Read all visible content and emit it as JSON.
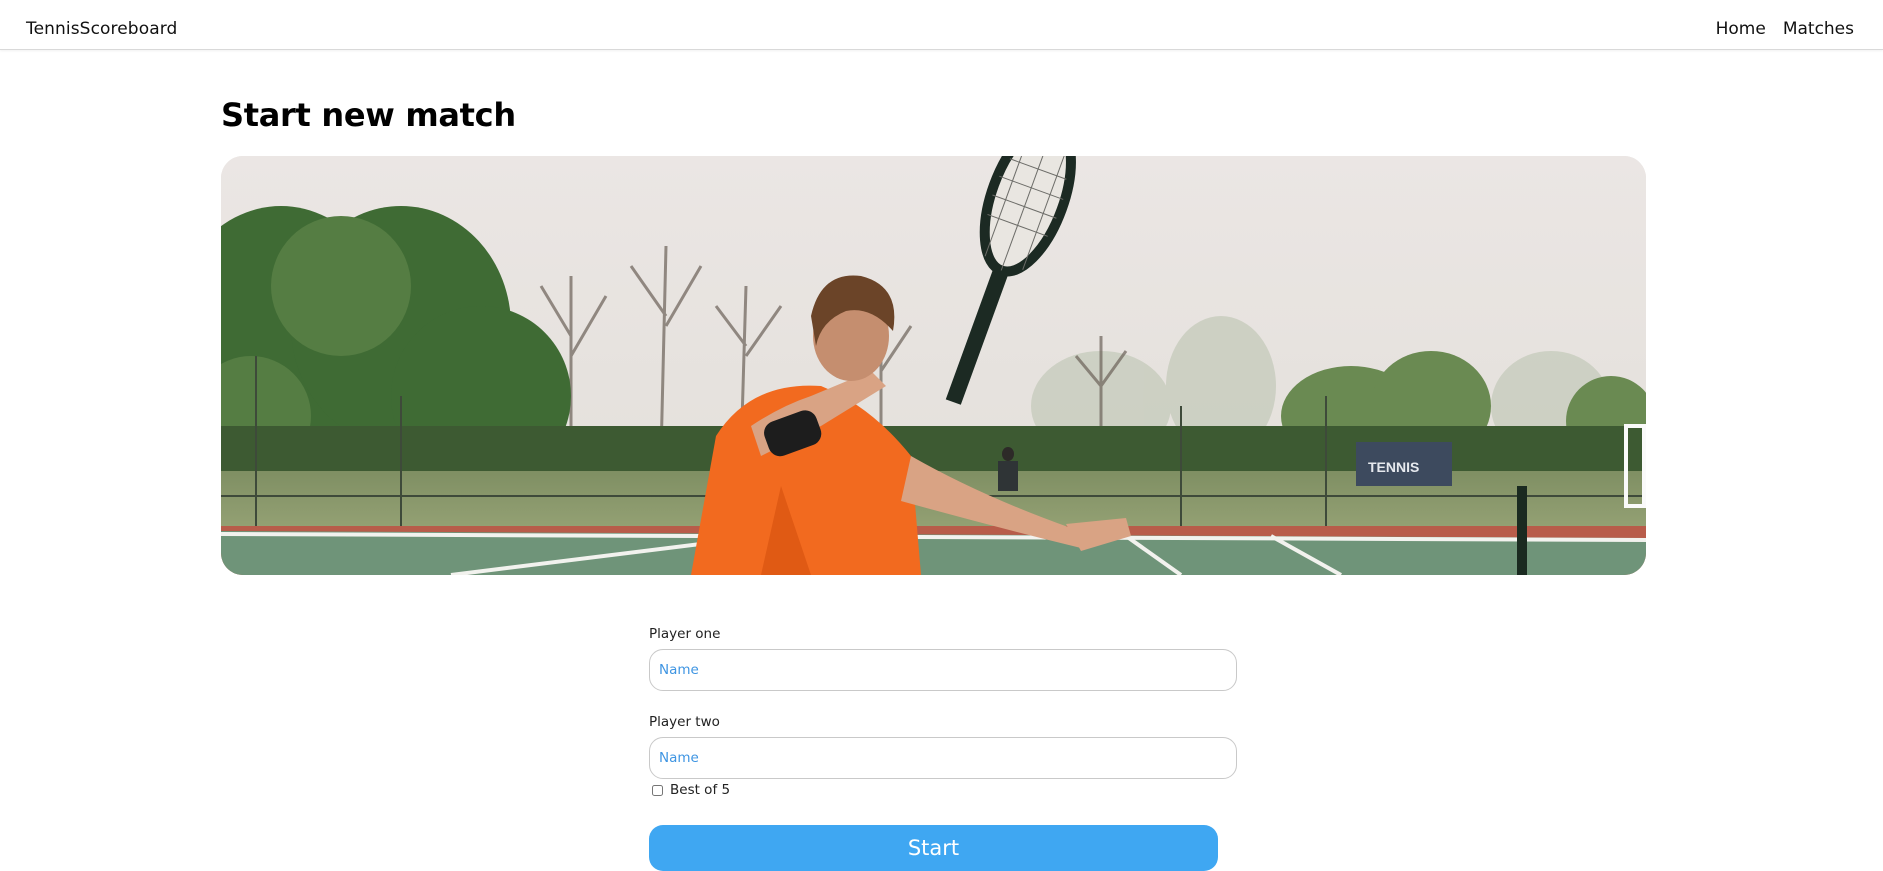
{
  "header": {
    "brand": "TennisScoreboard",
    "nav": {
      "home": "Home",
      "matches": "Matches"
    }
  },
  "main": {
    "title": "Start new match",
    "hero": {
      "sign_text": "TENNIS"
    },
    "form": {
      "player_one": {
        "label": "Player one",
        "placeholder": "Name",
        "value": ""
      },
      "player_two": {
        "label": "Player two",
        "placeholder": "Name",
        "value": ""
      },
      "best_of": {
        "label": "Best of 5",
        "checked": false
      },
      "submit_label": "Start"
    }
  },
  "colors": {
    "accent": "#3fa7f2",
    "placeholder": "#3f95e2",
    "shirt": "#f26a1f",
    "court": "#b85c4a"
  }
}
